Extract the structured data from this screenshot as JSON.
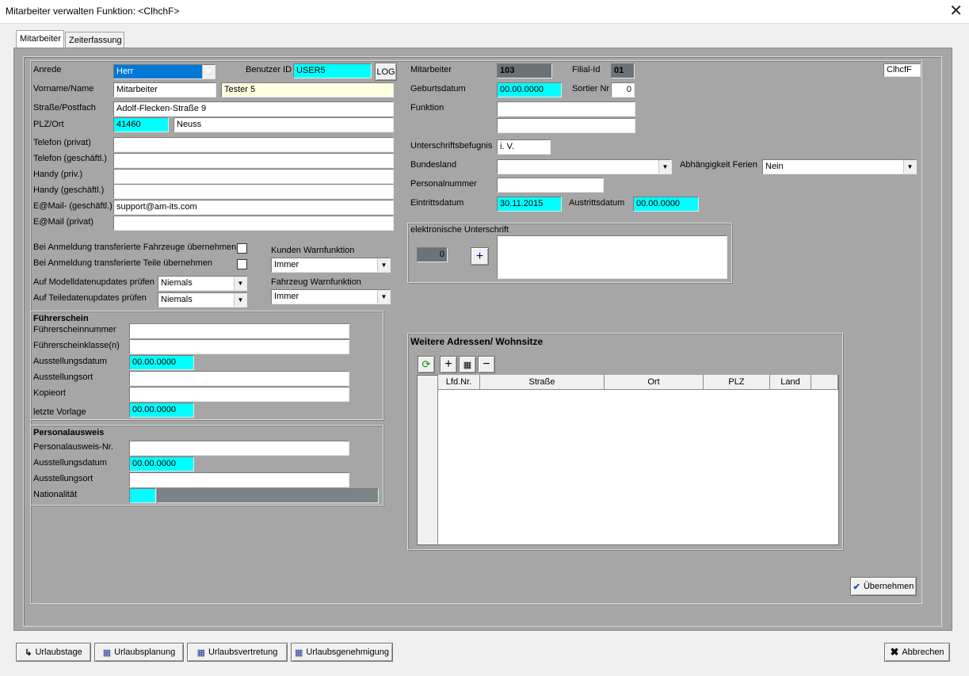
{
  "window": {
    "title": "Mitarbeiter verwalten Funktion: <ClhchF>"
  },
  "tabs": [
    "Mitarbeiter",
    "Zeiterfassung"
  ],
  "left": {
    "anrede_label": "Anrede",
    "anrede_value": "Herr",
    "benutzer_label": "Benutzer ID",
    "benutzer_value": "USER5",
    "log_button": "LOG",
    "name_label": "Vorname/Name",
    "vorname_value": "Mitarbeiter",
    "name_value": "Tester 5",
    "strasse_label": "Straße/Postfach",
    "strasse_value": "Adolf-Flecken-Straße 9",
    "plz_label": "PLZ/Ort",
    "plz_value": "41460",
    "ort_value": "Neuss",
    "tel_privat_label": "Telefon (privat)",
    "tel_geschaeft_label": "Telefon (geschäftl.)",
    "handy_priv_label": "Handy (priv.)",
    "handy_geschaeft_label": "Handy (geschäftl.)",
    "email_geschaeft_label": "E@Mail- (geschäftl.)",
    "email_geschaeft_value": "support@am-its.com",
    "email_privat_label": "E@Mail (privat)",
    "fahrzeuge_label": "Bei Anmeldung transferierte Fahrzeuge übernehmen",
    "teile_label": "Bei Anmeldung transferierte Teile übernehmen",
    "modell_label": "Auf Modelldatenupdates prüfen",
    "modell_value": "Niemals",
    "teiledaten_label": "Auf Teiledatenupdates prüfen",
    "teiledaten_value": "Niemals",
    "kunden_warn_label": "Kunden Warnfunktion",
    "kunden_warn_value": "Immer",
    "fahrzeug_warn_label": "Fahrzeug  Warnfunktion",
    "fahrzeug_warn_value": "Immer"
  },
  "fuehrerschein": {
    "title": "Führerschein",
    "nummer_label": "Führerscheinnummer",
    "klasse_label": "Führerscheinklasse(n)",
    "datum_label": "Ausstellungsdatum",
    "datum_value": "00.00.0000",
    "ort_label": "Ausstellungsort",
    "kopie_label": "Kopieort",
    "vorlage_label": "letzte Vorlage",
    "vorlage_value": "00.00.0000"
  },
  "personalausweis": {
    "title": "Personalausweis",
    "nr_label": "Personalausweis-Nr.",
    "datum_label": "Ausstellungsdatum",
    "datum_value": "00.00.0000",
    "ort_label": "Ausstellungsort",
    "nationalitaet_label": "Nationalität"
  },
  "right": {
    "mitarbeiter_label": "Mitarbeiter",
    "mitarbeiter_value": "103",
    "filial_label": "Filial-Id",
    "filial_value": "01",
    "code_value": "ClhcfF",
    "geburt_label": "Geburtsdatum",
    "geburt_value": "00.00.0000",
    "sortier_label": "Sortier Nr",
    "sortier_value": "0",
    "funktion_label": "Funktion",
    "unterschrift_label": "Unterschriftsbefugnis",
    "unterschrift_value": "i. V.",
    "bundesland_label": "Bundesland",
    "ferien_label": "Abhängigkeit Ferien",
    "ferien_value": "Nein",
    "personalnummer_label": "Personalnummer",
    "eintritt_label": "Eintrittsdatum",
    "eintritt_value": "30.11.2015",
    "austritt_label": "Austrittsdatum",
    "austritt_value": "00.00.0000",
    "esig_title": "elektronische Unterschrift",
    "esig_count": "0"
  },
  "adressen": {
    "title": "Weitere Adressen/ Wohnsitze",
    "columns": [
      "Lfd.Nr.",
      "Straße",
      "Ort",
      "PLZ",
      "Land"
    ]
  },
  "actions": {
    "uebernehmen": "Übernehmen",
    "abbrechen": "Abbrechen",
    "urlaubstage": "Urlaubstage",
    "urlaubsplanung": "Urlaubsplanung",
    "urlaubsvertretung": "Urlaubsvertretung",
    "urlaubsgenehmigung": "Urlaubsgenehmigung"
  }
}
